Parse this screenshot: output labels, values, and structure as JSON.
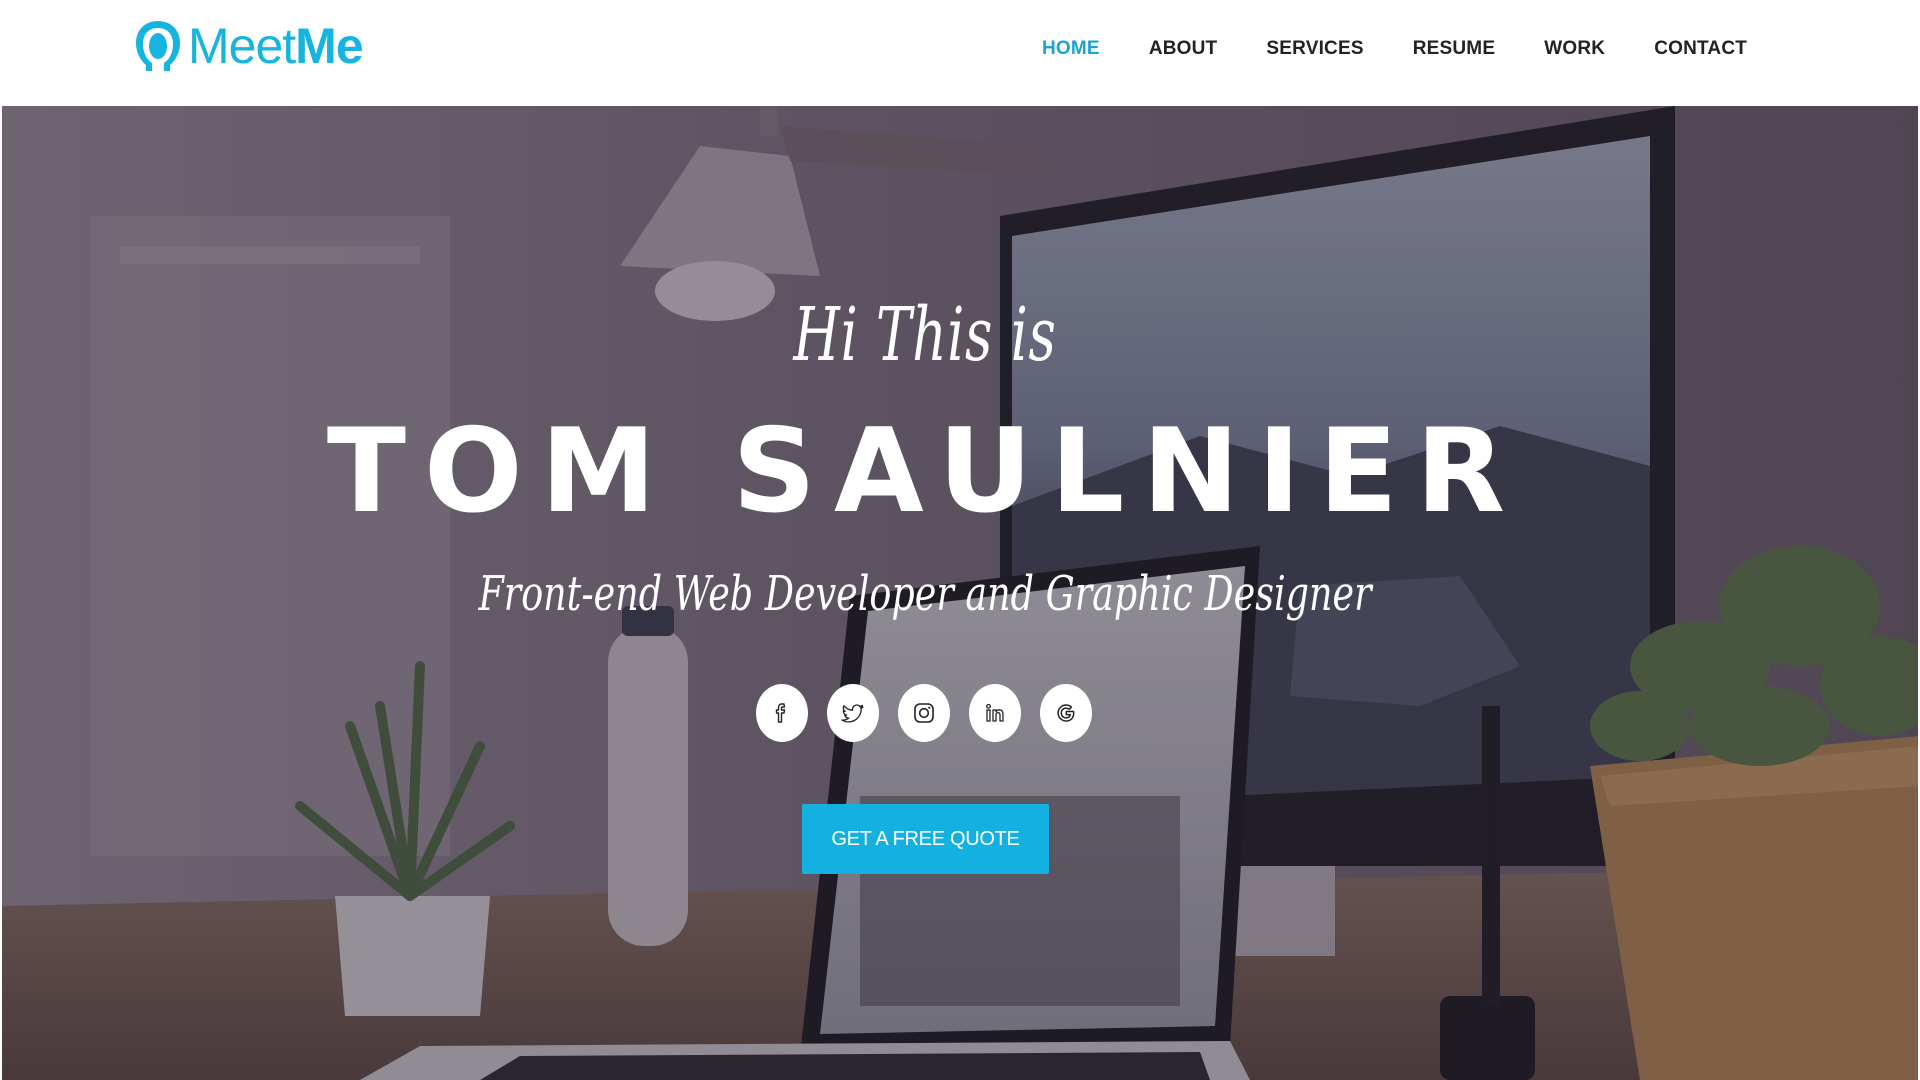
{
  "brand": {
    "logo_icon": "person-silhouette-icon",
    "name_light": "Meet",
    "name_bold": "Me",
    "accent_color": "#18b4e0"
  },
  "nav": {
    "items": [
      {
        "label": "HOME",
        "active": true
      },
      {
        "label": "ABOUT",
        "active": false
      },
      {
        "label": "SERVICES",
        "active": false
      },
      {
        "label": "RESUME",
        "active": false
      },
      {
        "label": "WORK",
        "active": false
      },
      {
        "label": "CONTACT",
        "active": false
      }
    ],
    "active_color": "#1da1d6",
    "text_color": "#222222"
  },
  "hero": {
    "greeting": "Hi This is",
    "name": "TOM SAULNIER",
    "tagline": "Front-end Web Developer and Graphic Designer",
    "background": "workspace photo: desk lamp, iMac, laptop, water bottle, potted plants (darkened overlay)",
    "socials": [
      {
        "icon": "facebook-icon"
      },
      {
        "icon": "twitter-icon"
      },
      {
        "icon": "instagram-icon"
      },
      {
        "icon": "linkedin-icon"
      },
      {
        "icon": "google-icon"
      }
    ],
    "cta_label": "GET A FREE QUOTE",
    "cta_color": "#14b1e0"
  }
}
